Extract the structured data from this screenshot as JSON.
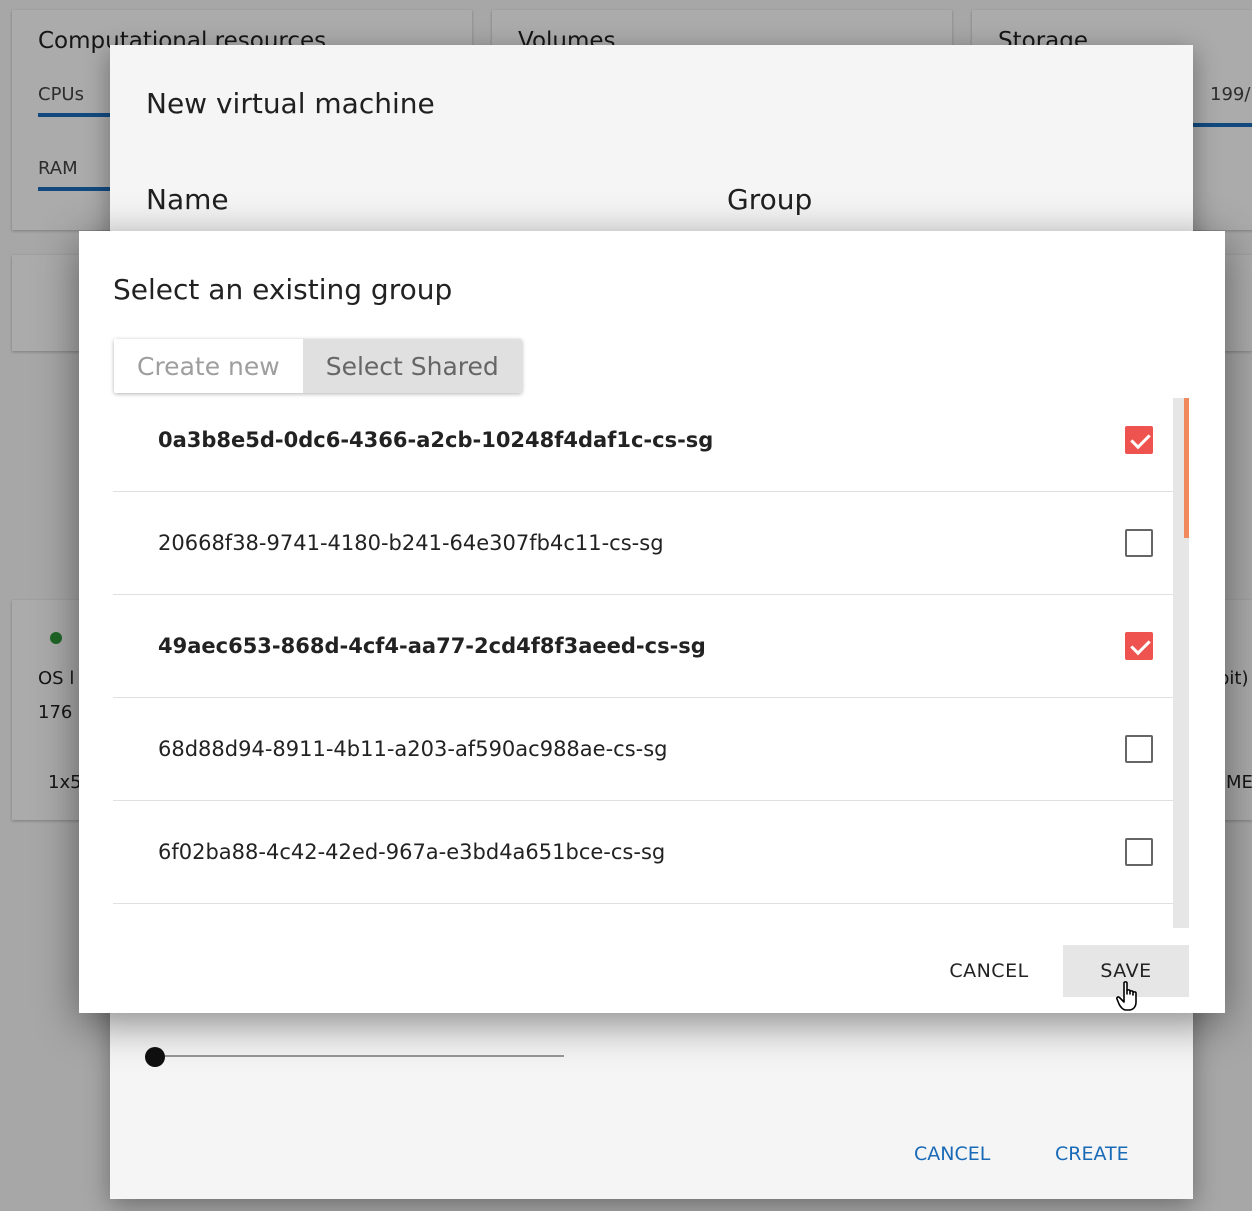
{
  "background": {
    "cards": [
      {
        "title": "Computational resources",
        "rows": [
          {
            "label": "CPUs",
            "fill": 0.4
          },
          {
            "label": "RAM",
            "fill": 0.55
          }
        ]
      },
      {
        "title": "Volumes"
      },
      {
        "title": "Storage",
        "rows": [
          {
            "label": "199/"
          }
        ]
      }
    ],
    "vm_card": {
      "os_label": "OS l",
      "number": "176",
      "size_prefix": "1x5",
      "right_tail_1": "bit)",
      "right_tail_2": "ME"
    }
  },
  "vm_dialog": {
    "title": "New virtual machine",
    "name_label": "Name",
    "group_label": "Group",
    "cancel_label": "CANCEL",
    "create_label": "CREATE"
  },
  "group_dialog": {
    "title": "Select an existing group",
    "tabs": [
      {
        "label": "Create new",
        "selected": false
      },
      {
        "label": "Select Shared",
        "selected": true
      }
    ],
    "groups": [
      {
        "name": "0a3b8e5d-0dc6-4366-a2cb-10248f4daf1c-cs-sg",
        "checked": true
      },
      {
        "name": "20668f38-9741-4180-b241-64e307fb4c11-cs-sg",
        "checked": false
      },
      {
        "name": "49aec653-868d-4cf4-aa77-2cd4f8f3aeed-cs-sg",
        "checked": true
      },
      {
        "name": "68d88d94-8911-4b11-a203-af590ac988ae-cs-sg",
        "checked": false
      },
      {
        "name": "6f02ba88-4c42-42ed-967a-e3bd4a651bce-cs-sg",
        "checked": false
      }
    ],
    "cancel_label": "CANCEL",
    "save_label": "SAVE"
  },
  "colors": {
    "checkbox_checked": "#ef5350",
    "scrollbar_thumb": "#f08a5d",
    "accent_blue": "#1b6fbf"
  }
}
